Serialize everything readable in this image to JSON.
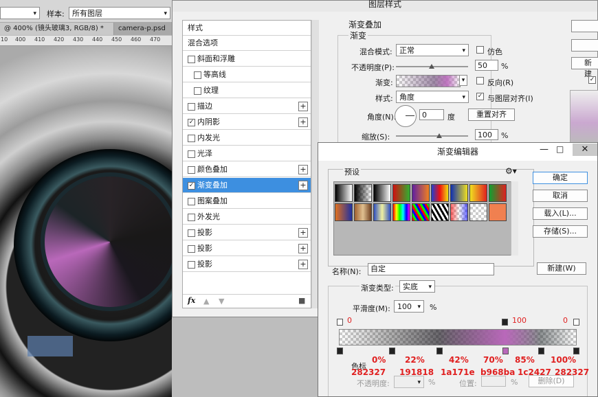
{
  "options_bar": {
    "sample_label": "样本:",
    "sample_value": "所有图层"
  },
  "doc_tabs": [
    {
      "label": "@ 400% (镜头玻璃3, RGB/8) *"
    },
    {
      "label": "camera-p.psd"
    }
  ],
  "ruler_ticks": [
    "10",
    "400",
    "410",
    "420",
    "430",
    "440",
    "450",
    "460",
    "470"
  ],
  "layer_style": {
    "title": "图层样式",
    "list": [
      {
        "label": "样式",
        "checkbox": false,
        "indent": 0
      },
      {
        "label": "混合选项",
        "checkbox": false,
        "indent": 0
      },
      {
        "label": "斜面和浮雕",
        "checkbox": true,
        "checked": false,
        "indent": 0
      },
      {
        "label": "等高线",
        "checkbox": true,
        "checked": false,
        "indent": 1
      },
      {
        "label": "纹理",
        "checkbox": true,
        "checked": false,
        "indent": 1
      },
      {
        "label": "描边",
        "checkbox": true,
        "checked": false,
        "plus": true
      },
      {
        "label": "内阴影",
        "checkbox": true,
        "checked": true,
        "plus": true
      },
      {
        "label": "内发光",
        "checkbox": true,
        "checked": false
      },
      {
        "label": "光泽",
        "checkbox": true,
        "checked": false
      },
      {
        "label": "颜色叠加",
        "checkbox": true,
        "checked": false,
        "plus": true
      },
      {
        "label": "渐变叠加",
        "checkbox": true,
        "checked": true,
        "plus": true,
        "active": true
      },
      {
        "label": "图案叠加",
        "checkbox": true,
        "checked": false
      },
      {
        "label": "外发光",
        "checkbox": true,
        "checked": false
      },
      {
        "label": "投影",
        "checkbox": true,
        "checked": false,
        "plus": true
      },
      {
        "label": "投影",
        "checkbox": true,
        "checked": false,
        "plus": true
      },
      {
        "label": "投影",
        "checkbox": true,
        "checked": false,
        "plus": true
      }
    ],
    "fx_label": "fx",
    "section_title": "渐变叠加",
    "group_title": "渐变",
    "blend_mode_label": "混合模式:",
    "blend_mode_value": "正常",
    "dither_label": "仿色",
    "opacity_label": "不透明度(P):",
    "opacity_value": "50",
    "pct": "%",
    "gradient_label": "渐变:",
    "reverse_label": "反向(R)",
    "style_label": "样式:",
    "style_value": "角度",
    "align_label": "与图层对齐(I)",
    "angle_label": "角度(N):",
    "angle_value": "0",
    "degree_label": "度",
    "reset_align_label": "重置对齐",
    "scale_label": "缩放(S):",
    "scale_value": "100",
    "right_new_label": "新建"
  },
  "gradient_editor": {
    "title": "渐变编辑器",
    "presets_label": "预设",
    "ok_label": "确定",
    "cancel_label": "取消",
    "load_label": "载入(L)...",
    "save_label": "存储(S)...",
    "name_label": "名称(N):",
    "name_value": "自定",
    "new_label": "新建(W)",
    "type_label": "渐变类型:",
    "type_value": "实底",
    "smooth_label": "平滑度(M):",
    "smooth_value": "100",
    "pct": "%",
    "opacity_stops": [
      "0",
      "100",
      "0"
    ],
    "stops_group_label": "色标",
    "stop_opacity_label": "不透明度:",
    "stop_pct": "%",
    "location_label": "位置:",
    "delete_label": "删除(D)",
    "annot_pcts": [
      "0%",
      "22%",
      "42%",
      "70%",
      "85%",
      "100%"
    ],
    "annot_hex": [
      "282327",
      "191818",
      "1a171e",
      "b968ba",
      "1c2427",
      "282327"
    ],
    "colors": {
      "c0": "#282327",
      "c1": "#191818",
      "c2": "#1a171e",
      "c3": "#b968ba",
      "c4": "#1c2427",
      "c5": "#282327",
      "annot": "#e02020"
    }
  }
}
